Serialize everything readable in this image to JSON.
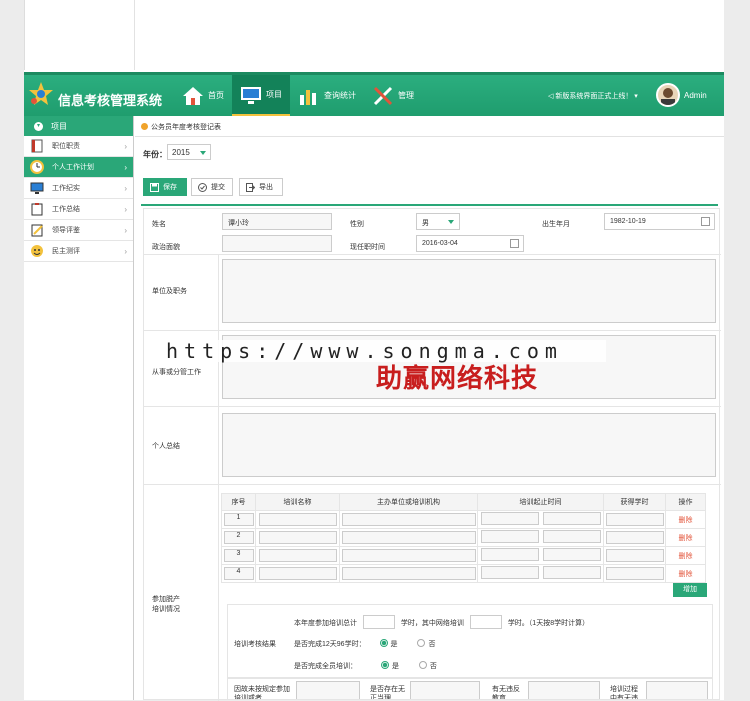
{
  "app": {
    "title": "信息考核管理系统",
    "notice": "新版系统界面正式上线！",
    "user": "Admin"
  },
  "nav": [
    {
      "label": "首页"
    },
    {
      "label": "项目"
    },
    {
      "label": "查询统计"
    },
    {
      "label": "管理"
    }
  ],
  "sidebar": {
    "header": "项目",
    "items": [
      {
        "label": "职位职责"
      },
      {
        "label": "个人工作计划"
      },
      {
        "label": "工作纪实"
      },
      {
        "label": "工作总结"
      },
      {
        "label": "领导评鉴"
      },
      {
        "label": "民主测评"
      }
    ]
  },
  "page": {
    "breadcrumb": "公务员年度考核登记表",
    "year_label": "年份：",
    "year_value": "2015",
    "buttons": {
      "save": "保存",
      "submit": "提交",
      "export": "导出"
    }
  },
  "form": {
    "name_label": "姓名",
    "name_value": "谭小玲",
    "gender_label": "性别",
    "gender_value": "男",
    "birth_label": "出生年月",
    "birth_value": "1982-10-19",
    "political_label": "政治面貌",
    "political_value": "",
    "hire_label": "现任职时间",
    "hire_value": "2016-03-04",
    "unit_label": "单位及职务",
    "work_label": "从事或分管工作",
    "summary_label": "个人总结",
    "training_label": "参加脱产培训情况",
    "training_label_1": "参加脱产",
    "training_label_2": "培训情况"
  },
  "training_table": {
    "headers": [
      "序号",
      "培训名称",
      "主办单位或培训机构",
      "培训起止时间",
      "获得学时",
      "操作"
    ],
    "rows": [
      {
        "no": "1",
        "action": "删除"
      },
      {
        "no": "2",
        "action": "删除"
      },
      {
        "no": "3",
        "action": "删除"
      },
      {
        "no": "4",
        "action": "删除"
      }
    ],
    "add_label": "增加"
  },
  "training_result": {
    "label": "培训考核结果",
    "hours_prefix": "本年度参加培训总计",
    "hours_mid": "学时，其中网络培训",
    "hours_suffix": "学时。（1天按8学时计算）",
    "q1": "是否完成12天96学时：",
    "q2": "是否完成全员培训：",
    "yes": "是",
    "no": "否"
  },
  "bottom_row": {
    "c1": "因故未按规定参加培训或者",
    "c2": "是否存在无正当理",
    "c3": "有无违反教育",
    "c4": "培训过程中有无违"
  },
  "watermark": {
    "url": "https://www.songma.com",
    "cn": "助赢网络科技"
  },
  "colors": {
    "brand": "#2aa778",
    "brand_dark": "#138259",
    "accent": "#f3c23d",
    "delete": "#e2543a",
    "watermark_red": "#c81e1e"
  }
}
